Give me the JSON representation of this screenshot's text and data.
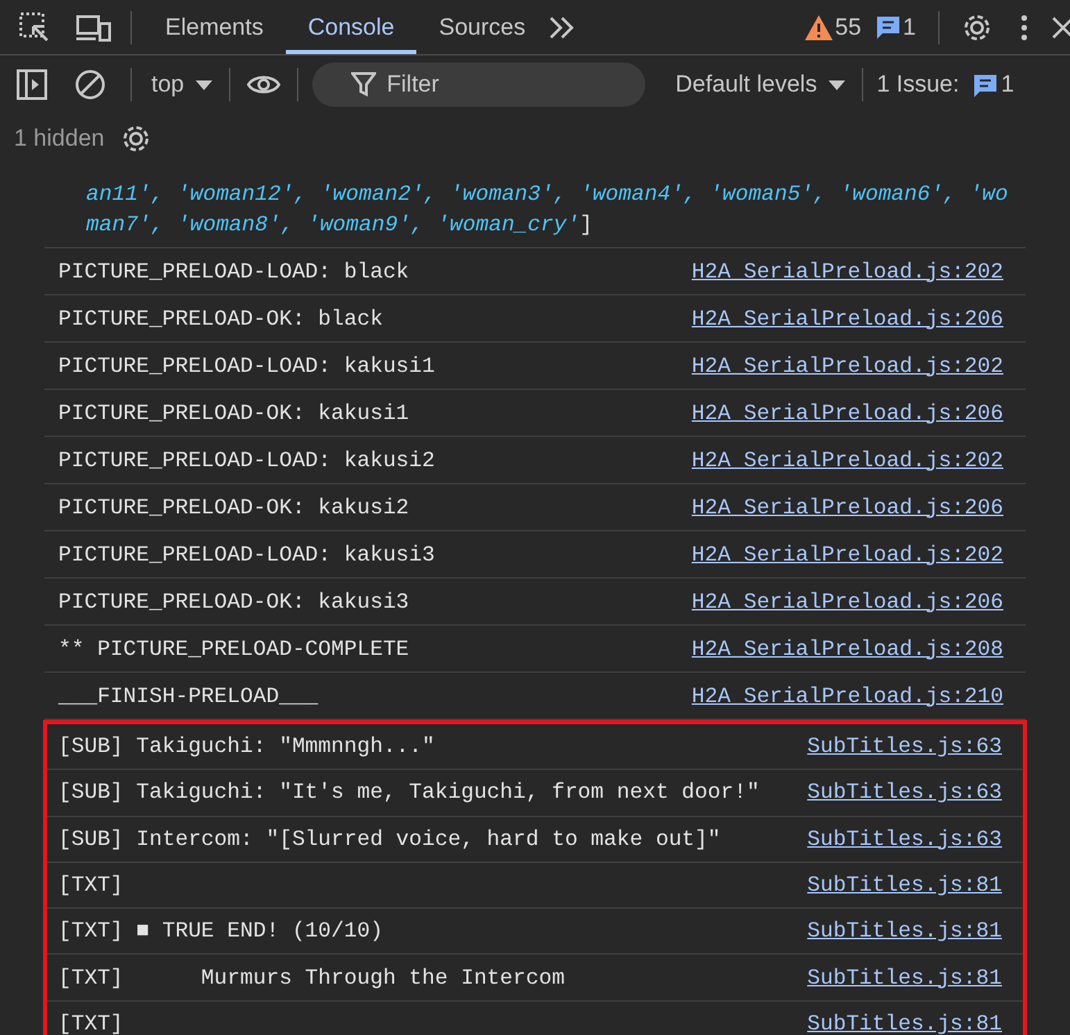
{
  "toolbar": {
    "tabs": [
      {
        "label": "Elements",
        "selected": false
      },
      {
        "label": "Console",
        "selected": true
      },
      {
        "label": "Sources",
        "selected": false
      }
    ],
    "warnings": "55",
    "messages": "1"
  },
  "console_bar": {
    "context": "top",
    "filter": {
      "placeholder": "Filter"
    },
    "levels": "Default levels",
    "issues_label": "1 Issue:",
    "issues_count": "1"
  },
  "hidden_count": "1 hidden",
  "log": {
    "continuation_lines": [
      "an11', 'woman12', 'woman2', 'woman3', 'woman4', 'woman5', 'woman6', 'wo",
      "man7', 'woman8', 'woman9', 'woman_cry'"
    ],
    "closing_bracket": "]",
    "entries": [
      {
        "message": "PICTURE_PRELOAD-LOAD: black",
        "source": "H2A_SerialPreload.js:202"
      },
      {
        "message": "PICTURE_PRELOAD-OK: black",
        "source": "H2A_SerialPreload.js:206"
      },
      {
        "message": "PICTURE_PRELOAD-LOAD: kakusi1",
        "source": "H2A_SerialPreload.js:202"
      },
      {
        "message": "PICTURE_PRELOAD-OK: kakusi1",
        "source": "H2A_SerialPreload.js:206"
      },
      {
        "message": "PICTURE_PRELOAD-LOAD: kakusi2",
        "source": "H2A_SerialPreload.js:202"
      },
      {
        "message": "PICTURE_PRELOAD-OK: kakusi2",
        "source": "H2A_SerialPreload.js:206"
      },
      {
        "message": "PICTURE_PRELOAD-LOAD: kakusi3",
        "source": "H2A_SerialPreload.js:202"
      },
      {
        "message": "PICTURE_PRELOAD-OK: kakusi3",
        "source": "H2A_SerialPreload.js:206"
      },
      {
        "message": "** PICTURE_PRELOAD-COMPLETE",
        "source": "H2A_SerialPreload.js:208"
      },
      {
        "message": "___FINISH-PRELOAD___",
        "source": "H2A_SerialPreload.js:210"
      }
    ],
    "highlighted_entries": [
      {
        "message": "[SUB] Takiguchi: \"Mmmnngh...\"",
        "source": "SubTitles.js:63"
      },
      {
        "message": "[SUB] Takiguchi: \"It's me, Takiguchi, from next door!\"",
        "source": "SubTitles.js:63"
      },
      {
        "message": "[SUB] Intercom: \"[Slurred voice, hard to make out]\"",
        "source": "SubTitles.js:63"
      },
      {
        "message": "[TXT]",
        "source": "SubTitles.js:81"
      },
      {
        "message": "[TXT] ■ TRUE END! (10/10)",
        "source": "SubTitles.js:81"
      },
      {
        "message": "[TXT]      Murmurs Through the Intercom",
        "source": "SubTitles.js:81"
      },
      {
        "message": "[TXT]",
        "source": "SubTitles.js:81"
      }
    ]
  }
}
